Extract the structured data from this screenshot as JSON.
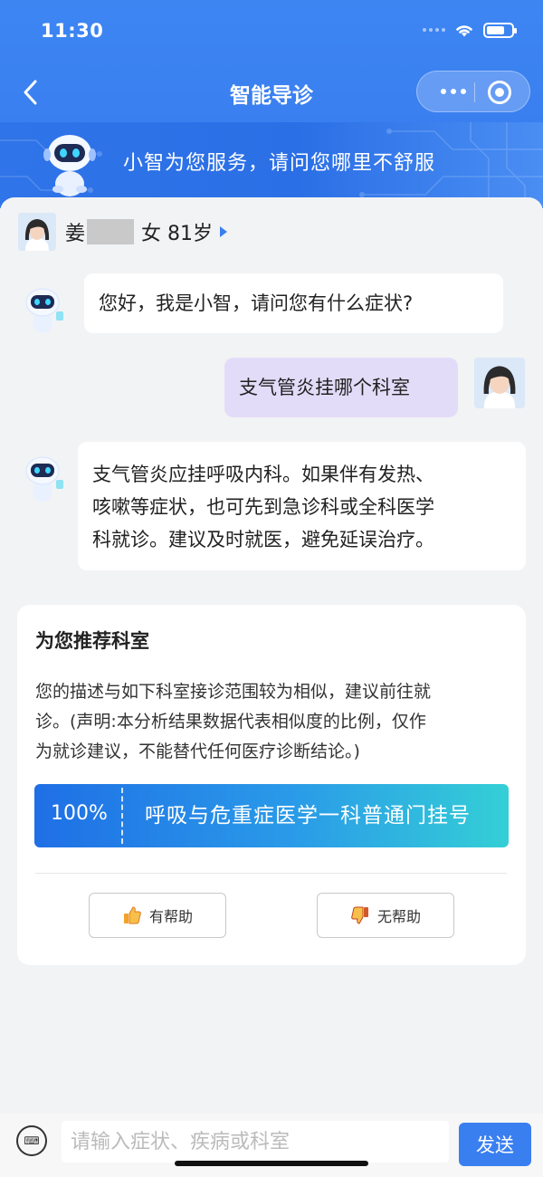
{
  "status_bar": {
    "time": "11:30"
  },
  "nav": {
    "title": "智能导诊"
  },
  "banner": {
    "text": "小智为您服务，请问您哪里不舒服"
  },
  "patient": {
    "surname": "姜",
    "info": "女 81岁"
  },
  "messages": [
    {
      "from": "bot",
      "text": "您好，我是小智，请问您有什么症状?"
    },
    {
      "from": "user",
      "text": "支气管炎挂哪个科室"
    },
    {
      "from": "bot",
      "lines": [
        "支气管炎应挂呼吸内科。如果伴有发热、",
        "咳嗽等症状，也可先到急诊科或全科医学",
        "科就诊。建议及时就医，避免延误治疗。"
      ]
    }
  ],
  "recommend": {
    "title": "为您推荐科室",
    "desc_lines": [
      "您的描述与如下科室接诊范围较为相似，建议前往就",
      "诊。(声明:本分析结果数据代表相似度的比例，仅作",
      "为就诊建议，不能替代任何医疗诊断结论。)"
    ],
    "department": {
      "percent": "100%",
      "name": "呼吸与危重症医学一科普通门挂号"
    },
    "helpful_label": "有帮助",
    "unhelpful_label": "无帮助"
  },
  "input": {
    "placeholder": "请输入症状、疾病或科室",
    "send_label": "发送"
  },
  "colors": {
    "primary": "#3a7ff0",
    "user_bubble": "#e3dcf8",
    "dept_gradient_end": "#34cfd6"
  }
}
